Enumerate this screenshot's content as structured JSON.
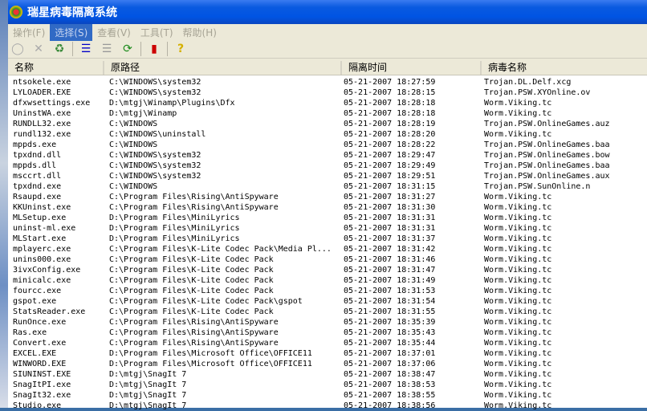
{
  "title": "瑞星病毒隔离系统",
  "menu": [
    "操作(F)",
    "选择(S)",
    "查看(V)",
    "工具(T)",
    "帮助(H)"
  ],
  "columns": [
    "名称",
    "原路径",
    "隔离时间",
    "病毒名称"
  ],
  "rows": [
    [
      "ntsokele.exe",
      "C:\\WINDOWS\\system32",
      "05-21-2007 18:27:59",
      "Trojan.DL.Delf.xcg"
    ],
    [
      "LYLOADER.EXE",
      "C:\\WINDOWS\\system32",
      "05-21-2007 18:28:15",
      "Trojan.PSW.XYOnline.ov"
    ],
    [
      "dfxwsettings.exe",
      "D:\\mtgj\\Winamp\\Plugins\\Dfx",
      "05-21-2007 18:28:18",
      "Worm.Viking.tc"
    ],
    [
      "UninstWA.exe",
      "D:\\mtgj\\Winamp",
      "05-21-2007 18:28:18",
      "Worm.Viking.tc"
    ],
    [
      "RUNDLL32.exe",
      "C:\\WINDOWS",
      "05-21-2007 18:28:19",
      "Trojan.PSW.OnlineGames.auz"
    ],
    [
      "rundl132.exe",
      "C:\\WINDOWS\\uninstall",
      "05-21-2007 18:28:20",
      "Worm.Viking.tc"
    ],
    [
      "mppds.exe",
      "C:\\WINDOWS",
      "05-21-2007 18:28:22",
      "Trojan.PSW.OnlineGames.baa"
    ],
    [
      "tpxdnd.dll",
      "C:\\WINDOWS\\system32",
      "05-21-2007 18:29:47",
      "Trojan.PSW.OnlineGames.bow"
    ],
    [
      "mppds.dll",
      "C:\\WINDOWS\\system32",
      "05-21-2007 18:29:49",
      "Trojan.PSW.OnlineGames.baa"
    ],
    [
      "msccrt.dll",
      "C:\\WINDOWS\\system32",
      "05-21-2007 18:29:51",
      "Trojan.PSW.OnlineGames.aux"
    ],
    [
      "tpxdnd.exe",
      "C:\\WINDOWS",
      "05-21-2007 18:31:15",
      "Trojan.PSW.SunOnline.n"
    ],
    [
      "Rsaupd.exe",
      "C:\\Program Files\\Rising\\AntiSpyware",
      "05-21-2007 18:31:27",
      "Worm.Viking.tc"
    ],
    [
      "KKUninst.exe",
      "C:\\Program Files\\Rising\\AntiSpyware",
      "05-21-2007 18:31:30",
      "Worm.Viking.tc"
    ],
    [
      "MLSetup.exe",
      "D:\\Program Files\\MiniLyrics",
      "05-21-2007 18:31:31",
      "Worm.Viking.tc"
    ],
    [
      "uninst-ml.exe",
      "D:\\Program Files\\MiniLyrics",
      "05-21-2007 18:31:31",
      "Worm.Viking.tc"
    ],
    [
      "MLStart.exe",
      "D:\\Program Files\\MiniLyrics",
      "05-21-2007 18:31:37",
      "Worm.Viking.tc"
    ],
    [
      "mplayerc.exe",
      "C:\\Program Files\\K-Lite Codec Pack\\Media Pl...",
      "05-21-2007 18:31:42",
      "Worm.Viking.tc"
    ],
    [
      "unins000.exe",
      "C:\\Program Files\\K-Lite Codec Pack",
      "05-21-2007 18:31:46",
      "Worm.Viking.tc"
    ],
    [
      "3ivxConfig.exe",
      "C:\\Program Files\\K-Lite Codec Pack",
      "05-21-2007 18:31:47",
      "Worm.Viking.tc"
    ],
    [
      "minicalc.exe",
      "C:\\Program Files\\K-Lite Codec Pack",
      "05-21-2007 18:31:49",
      "Worm.Viking.tc"
    ],
    [
      "fourcc.exe",
      "C:\\Program Files\\K-Lite Codec Pack",
      "05-21-2007 18:31:53",
      "Worm.Viking.tc"
    ],
    [
      "gspot.exe",
      "C:\\Program Files\\K-Lite Codec Pack\\gspot",
      "05-21-2007 18:31:54",
      "Worm.Viking.tc"
    ],
    [
      "StatsReader.exe",
      "C:\\Program Files\\K-Lite Codec Pack",
      "05-21-2007 18:31:55",
      "Worm.Viking.tc"
    ],
    [
      "RunOnce.exe",
      "C:\\Program Files\\Rising\\AntiSpyware",
      "05-21-2007 18:35:39",
      "Worm.Viking.tc"
    ],
    [
      "Ras.exe",
      "C:\\Program Files\\Rising\\AntiSpyware",
      "05-21-2007 18:35:43",
      "Worm.Viking.tc"
    ],
    [
      "Convert.exe",
      "C:\\Program Files\\Rising\\AntiSpyware",
      "05-21-2007 18:35:44",
      "Worm.Viking.tc"
    ],
    [
      "EXCEL.EXE",
      "D:\\Program Files\\Microsoft Office\\OFFICE11",
      "05-21-2007 18:37:01",
      "Worm.Viking.tc"
    ],
    [
      "WINWORD.EXE",
      "D:\\Program Files\\Microsoft Office\\OFFICE11",
      "05-21-2007 18:37:06",
      "Worm.Viking.tc"
    ],
    [
      "SIUNINST.EXE",
      "D:\\mtgj\\SnagIt 7",
      "05-21-2007 18:38:47",
      "Worm.Viking.tc"
    ],
    [
      "SnagItPI.exe",
      "D:\\mtgj\\SnagIt 7",
      "05-21-2007 18:38:53",
      "Worm.Viking.tc"
    ],
    [
      "SnagIt32.exe",
      "D:\\mtgj\\SnagIt 7",
      "05-21-2007 18:38:55",
      "Worm.Viking.tc"
    ],
    [
      "Studio.exe",
      "D:\\mtgj\\SnagIt 7",
      "05-21-2007 18:38:56",
      "Worm.Viking.tc"
    ]
  ]
}
